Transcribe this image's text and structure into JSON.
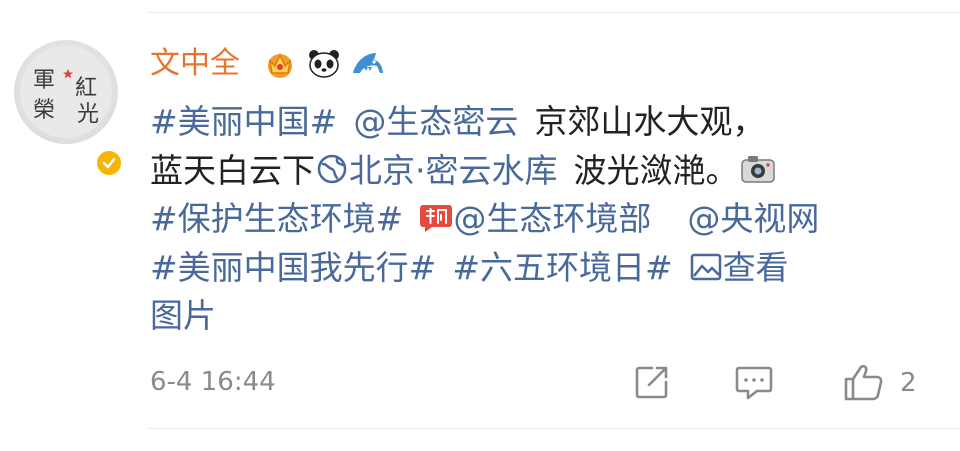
{
  "post": {
    "username": "文中全",
    "avatar_text": [
      "軍",
      "榮",
      "紅",
      "光"
    ],
    "badges": [
      "crown-badge-icon",
      "panda-badge-icon",
      "shark-badge-icon"
    ],
    "content": {
      "line1": {
        "tag1": "#美丽中国#",
        "mention1": "@生态密云",
        "text1": "京郊山水大观，"
      },
      "line2": {
        "text1": "蓝天白云下",
        "location": "北京·密云水库",
        "text2": "波光潋滟。"
      },
      "line3": {
        "tag1": "#保护生态环境#",
        "mention1": "@生态环境部",
        "mention2": "@央视网"
      },
      "line4": {
        "tag1": "#美丽中国我先行#",
        "tag2": "#六五环境日#",
        "view_images_prefix": "查看"
      },
      "line5": {
        "view_images_suffix": "图片"
      }
    },
    "timestamp": "6-4 16:44",
    "like_count": "2"
  },
  "colors": {
    "link": "#49699a",
    "username": "#e8732f",
    "verified": "#f7b500",
    "meta": "#8a8a8a"
  }
}
